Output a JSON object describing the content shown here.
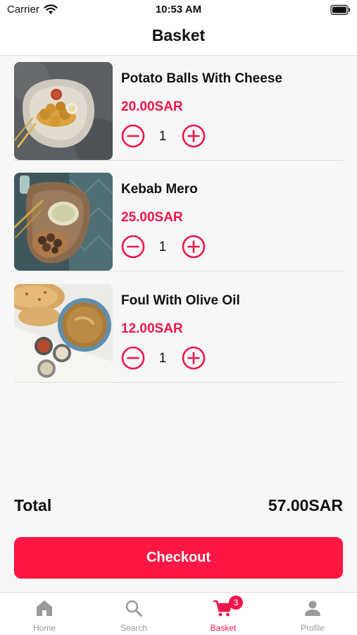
{
  "status_bar": {
    "carrier": "Carrier",
    "time": "10:53 AM"
  },
  "header": {
    "title": "Basket"
  },
  "basket": {
    "items": [
      {
        "name": "Potato Balls With Cheese",
        "price": "20.00SAR",
        "quantity": "1",
        "image_icon": "potato-balls-photo"
      },
      {
        "name": "Kebab Mero",
        "price": "25.00SAR",
        "quantity": "1",
        "image_icon": "kebab-photo"
      },
      {
        "name": "Foul With Olive Oil",
        "price": "12.00SAR",
        "quantity": "1",
        "image_icon": "foul-photo"
      }
    ],
    "total_label": "Total",
    "total_value": "57.00SAR",
    "checkout_label": "Checkout"
  },
  "tab_bar": {
    "active_tab": "basket",
    "tabs": [
      {
        "id": "home",
        "label": "Home",
        "icon": "home-icon"
      },
      {
        "id": "search",
        "label": "Search",
        "icon": "search-icon"
      },
      {
        "id": "basket",
        "label": "Basket",
        "icon": "cart-icon",
        "badge": "3"
      },
      {
        "id": "profile",
        "label": "Profile",
        "icon": "person-icon"
      }
    ]
  },
  "colors": {
    "accent": "#f0164b",
    "button": "#ff1744",
    "background": "#f7f7f7",
    "inactive_tab": "#9a9a9a"
  }
}
